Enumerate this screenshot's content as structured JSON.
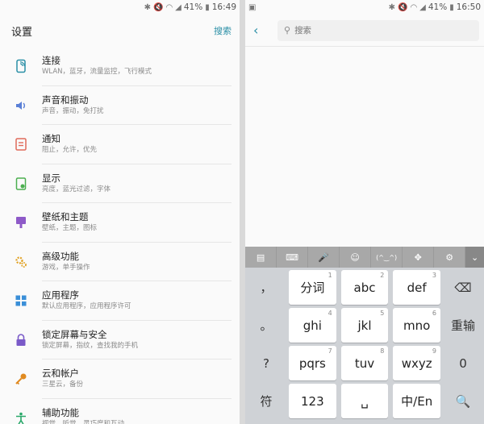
{
  "left": {
    "status": {
      "bt": "✱",
      "mute": "🔇",
      "wifi": "◠",
      "signal": "◢",
      "battery_pct": "41%",
      "battery": "▮",
      "time": "16:49"
    },
    "title": "设置",
    "search_label": "搜索",
    "items": [
      {
        "name": "连接",
        "sub": "WLAN，蓝牙，流量监控，飞行模式",
        "icon": "connection-icon",
        "color": "#2a8fa6"
      },
      {
        "name": "声音和振动",
        "sub": "声音，振动，免打扰",
        "icon": "speaker-icon",
        "color": "#5a7fd6"
      },
      {
        "name": "通知",
        "sub": "阻止，允许，优先",
        "icon": "notification-icon",
        "color": "#e06a5a"
      },
      {
        "name": "显示",
        "sub": "亮度，蓝光过滤，字体",
        "icon": "display-icon",
        "color": "#4caf50"
      },
      {
        "name": "壁纸和主题",
        "sub": "壁纸，主题，图标",
        "icon": "wallpaper-icon",
        "color": "#8e5ac8"
      },
      {
        "name": "高级功能",
        "sub": "游戏，单手操作",
        "icon": "advanced-icon",
        "color": "#e0a020"
      },
      {
        "name": "应用程序",
        "sub": "默认应用程序，应用程序许可",
        "icon": "apps-icon",
        "color": "#3a8fd8"
      },
      {
        "name": "锁定屏幕与安全",
        "sub": "锁定屏幕，指纹，查找我的手机",
        "icon": "lock-icon",
        "color": "#7a5ac8"
      },
      {
        "name": "云和帐户",
        "sub": "三星云，备份",
        "icon": "key-icon",
        "color": "#e08a20"
      },
      {
        "name": "辅助功能",
        "sub": "视觉，听觉，灵巧度和互动",
        "icon": "accessibility-icon",
        "color": "#2aa86a"
      }
    ]
  },
  "right": {
    "status": {
      "image": "▣",
      "bt": "✱",
      "mute": "🔇",
      "wifi": "◠",
      "signal": "◢",
      "battery_pct": "41%",
      "battery": "▮",
      "time": "16:50"
    },
    "back": "‹",
    "search_placeholder": "搜索",
    "toolbar": [
      "clipboard-icon",
      "keyboard-icon",
      "microphone-icon",
      "emoji-icon",
      "kaomoji-icon",
      "move-icon",
      "settings-icon",
      "collapse-icon"
    ],
    "keyboard": {
      "row1": {
        "left": "，",
        "keys": [
          {
            "label": "分词",
            "num": "1"
          },
          {
            "label": "abc",
            "num": "2"
          },
          {
            "label": "def",
            "num": "3"
          }
        ],
        "right": "⌫"
      },
      "row2": {
        "left": "。",
        "keys": [
          {
            "label": "ghi",
            "num": "4"
          },
          {
            "label": "jkl",
            "num": "5"
          },
          {
            "label": "mno",
            "num": "6"
          }
        ],
        "right": "重输"
      },
      "row3": {
        "left": "?",
        "keys": [
          {
            "label": "pqrs",
            "num": "7"
          },
          {
            "label": "tuv",
            "num": "8"
          },
          {
            "label": "wxyz",
            "num": "9"
          }
        ],
        "right": "0"
      },
      "row4": {
        "left": "符",
        "keys": [
          {
            "label": "123",
            "num": ""
          },
          {
            "label": "␣",
            "num": ""
          },
          {
            "label": "中/En",
            "num": ""
          }
        ],
        "right": "🔍"
      }
    }
  }
}
